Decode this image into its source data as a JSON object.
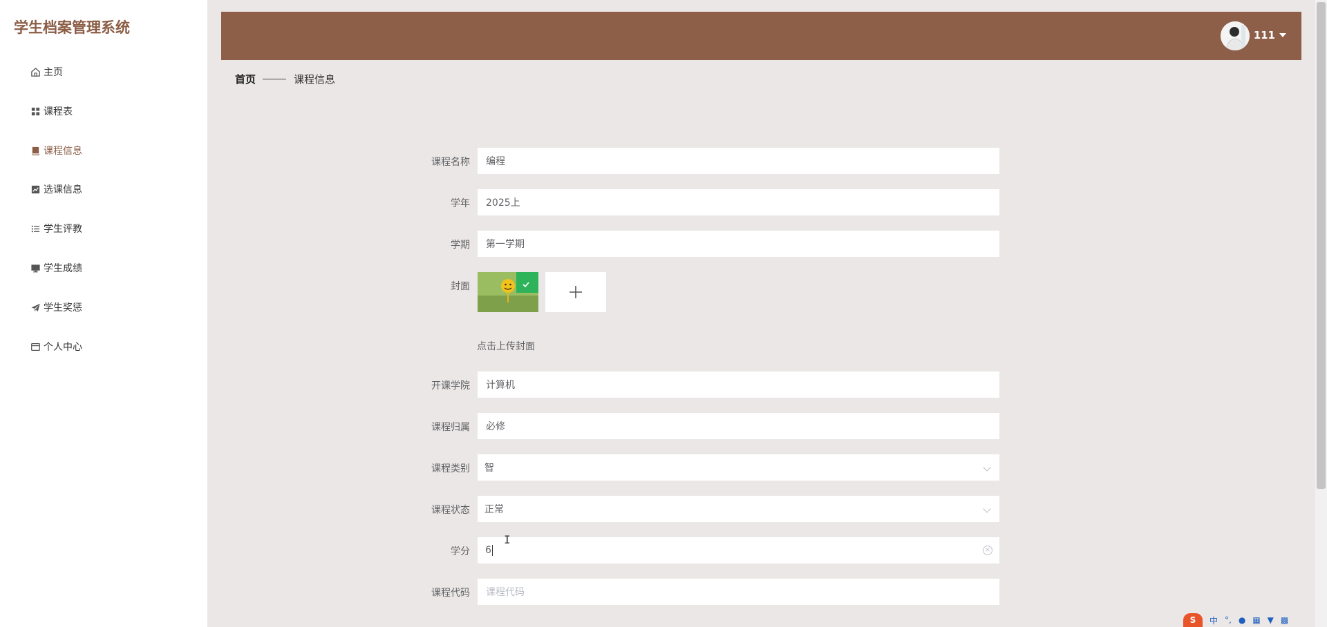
{
  "app": {
    "title": "学生档案管理系统"
  },
  "sidebar": {
    "items": [
      {
        "label": "主页",
        "icon": "home-icon"
      },
      {
        "label": "课程表",
        "icon": "grid-icon"
      },
      {
        "label": "课程信息",
        "icon": "book-icon",
        "active": true
      },
      {
        "label": "选课信息",
        "icon": "chart-icon"
      },
      {
        "label": "学生评教",
        "icon": "list-icon"
      },
      {
        "label": "学生成绩",
        "icon": "monitor-icon"
      },
      {
        "label": "学生奖惩",
        "icon": "send-icon"
      },
      {
        "label": "个人中心",
        "icon": "window-icon"
      }
    ]
  },
  "header": {
    "username": "111",
    "avatar_icon": "user-avatar-icon"
  },
  "breadcrumb": {
    "home": "首页",
    "current": "课程信息"
  },
  "form": {
    "course_name": {
      "label": "课程名称",
      "value": "编程"
    },
    "school_year": {
      "label": "学年",
      "value": "2025上"
    },
    "semester": {
      "label": "学期",
      "value": "第一学期"
    },
    "cover": {
      "label": "封面",
      "hint": "点击上传封面",
      "upload_icon": "plus-icon"
    },
    "college": {
      "label": "开课学院",
      "value": "计算机"
    },
    "course_type": {
      "label": "课程归属",
      "value": "必修"
    },
    "category": {
      "label": "课程类别",
      "value": "智"
    },
    "status": {
      "label": "课程状态",
      "value": "正常"
    },
    "credit": {
      "label": "学分",
      "value": "6"
    },
    "code": {
      "label": "课程代码",
      "placeholder": "课程代码"
    }
  },
  "ime": {
    "logo": "S",
    "mode": "中",
    "punct": "°,"
  },
  "colors": {
    "accent": "#8b5d45",
    "topbar": "#8d5e48",
    "background": "#ebe7e6"
  }
}
